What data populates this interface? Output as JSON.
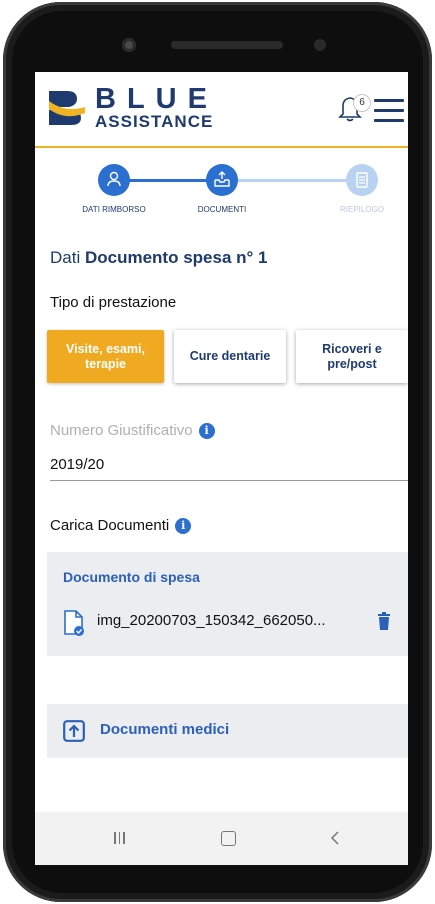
{
  "brand": {
    "line1": "BLUE",
    "line2": "ASSISTANCE",
    "color": "#1e3a6e",
    "accent": "#f0b323"
  },
  "header": {
    "notifications_count": "6",
    "bell_icon": "bell-icon",
    "menu_icon": "hamburger-menu-icon"
  },
  "stepper": {
    "steps": [
      {
        "label": "DATI RIMBORSO",
        "icon": "person-icon",
        "state": "done"
      },
      {
        "label": "DOCUMENTI",
        "icon": "upload-tray-icon",
        "state": "active"
      },
      {
        "label": "RIEPILOGO",
        "icon": "clipboard-icon",
        "state": "pending"
      }
    ]
  },
  "page": {
    "title_prefix": "Dati",
    "title_bold": "Documento spesa n° 1"
  },
  "tipo": {
    "label": "Tipo di prestazione",
    "options": [
      {
        "label": "Visite, esami, terapie",
        "selected": true
      },
      {
        "label": "Cure dentarie",
        "selected": false
      },
      {
        "label": "Ricoveri e pre/post",
        "selected": false
      }
    ]
  },
  "numero": {
    "label": "Numero Giustificativo",
    "info": "i",
    "value": "2019/20"
  },
  "carica": {
    "label": "Carica Documenti",
    "info": "i"
  },
  "documento_spesa": {
    "title": "Documento di spesa",
    "file_name": "img_20200703_150342_662050...",
    "file_icon": "file-check-icon",
    "delete_icon": "trash-icon"
  },
  "documenti_medici": {
    "label": "Documenti medici",
    "icon": "upload-icon"
  },
  "android_nav": {
    "recents_icon": "recents-icon",
    "home_icon": "home-icon",
    "back_icon": "back-icon"
  }
}
